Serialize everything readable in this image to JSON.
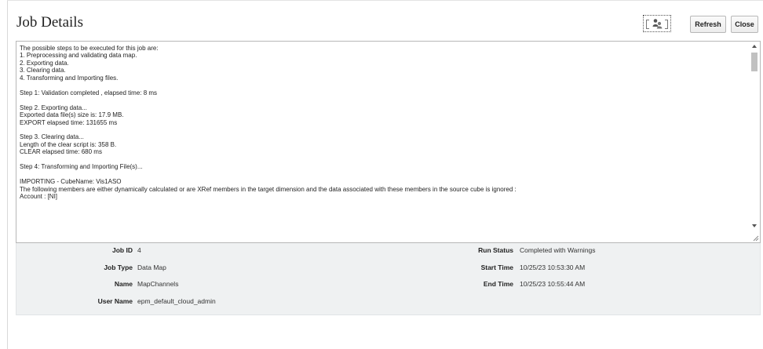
{
  "header": {
    "title": "Job Details",
    "refresh_label": "Refresh",
    "close_label": "Close"
  },
  "log": {
    "text": "The possible steps to be executed for this job are:\n1. Preprocessing and validating data map.\n2. Exporting data.\n3. Clearing data.\n4. Transforming and Importing files.\n\nStep 1: Validation completed , elapsed time: 8 ms\n\nStep 2. Exporting data...\nExported data file(s) size is: 17.9 MB.\nEXPORT elapsed time: 131655 ms\n\nStep 3. Clearing data...\nLength of the clear script is: 358 B.\nCLEAR elapsed time: 680 ms\n\nStep 4: Transforming and Importing File(s)...\n\nIMPORTING - CubeName: Vis1ASO\nThe following members are either dynamically calculated or are XRef members in the target dimension and the data associated with these members in the source cube is ignored :\nAccount : [NI]"
  },
  "details": {
    "job_id_label": "Job ID",
    "job_id": "4",
    "job_type_label": "Job Type",
    "job_type": "Data Map",
    "name_label": "Name",
    "name": "MapChannels",
    "user_name_label": "User Name",
    "user_name": "epm_default_cloud_admin",
    "run_status_label": "Run Status",
    "run_status": "Completed with Warnings",
    "start_time_label": "Start Time",
    "start_time": "10/25/23 10:53:30 AM",
    "end_time_label": "End Time",
    "end_time": "10/25/23 10:55:44 AM"
  },
  "icons": {
    "user_action_icon": "user-group-icon"
  }
}
